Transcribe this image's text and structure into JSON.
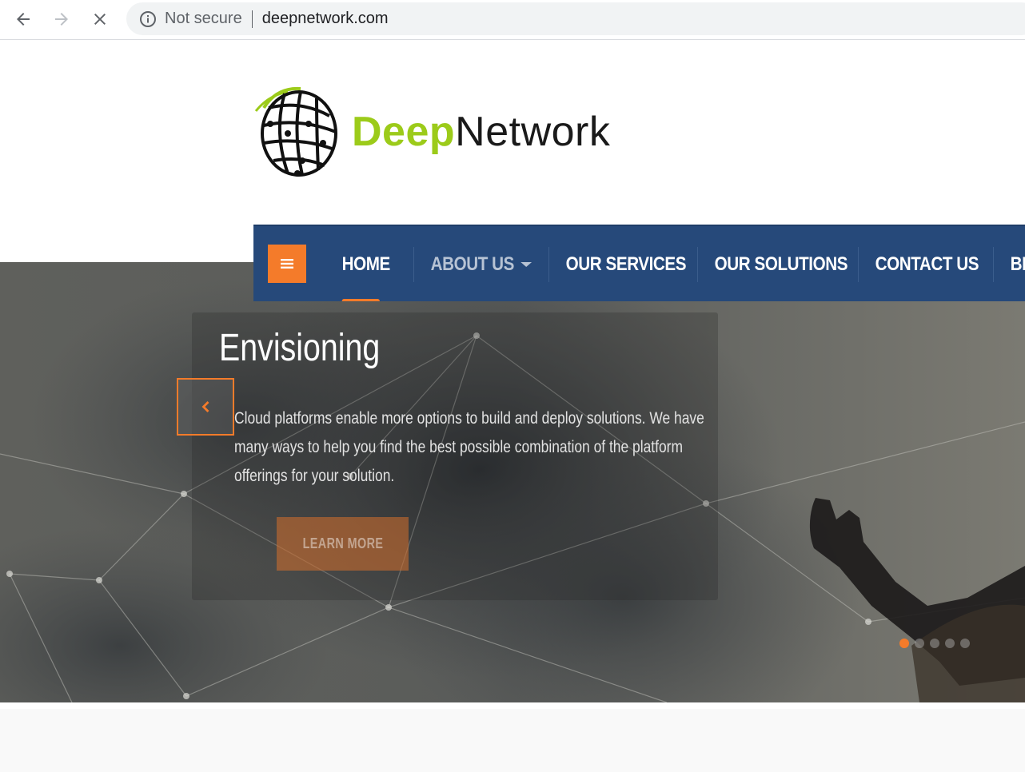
{
  "browser": {
    "security_label": "Not secure",
    "url": "deepnetwork.com"
  },
  "logo": {
    "part1": "Deep",
    "part2": "Network"
  },
  "nav": {
    "items": [
      {
        "label": "HOME"
      },
      {
        "label": "ABOUT US"
      },
      {
        "label": "OUR SERVICES"
      },
      {
        "label": "OUR SOLUTIONS"
      },
      {
        "label": "CONTACT US"
      },
      {
        "label": "BLOG"
      }
    ]
  },
  "slide": {
    "title": "Envisioning",
    "text": "Cloud platforms enable more options to build and deploy solutions. We have many ways to help you find the best possible combination of the platform offerings for your solution.",
    "button_label": "LEARN MORE",
    "total_slides": 5,
    "active_slide": 1
  },
  "colors": {
    "accent": "#f47b2a",
    "nav_bg": "#26497a",
    "logo_green": "#9ccb1a"
  },
  "icons": [
    "back-arrow-icon",
    "forward-arrow-icon",
    "stop-icon",
    "info-icon",
    "hamburger-icon",
    "chevron-left-icon",
    "caret-down-icon",
    "globe-logo-icon"
  ]
}
